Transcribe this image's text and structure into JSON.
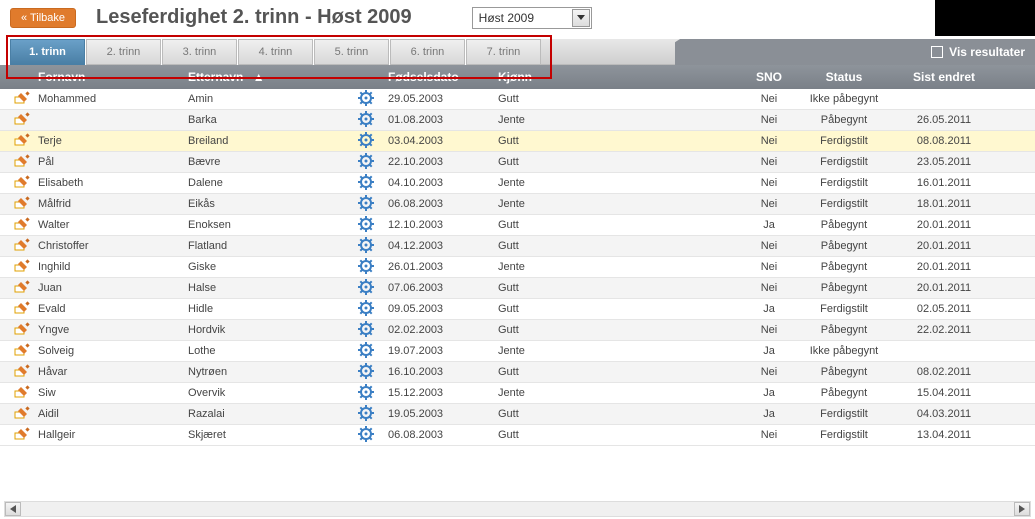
{
  "header": {
    "back_label": "« Tilbake",
    "title": "Leseferdighet 2. trinn - Høst 2009",
    "dropdown_value": "Høst 2009",
    "vis_resultater": "Vis resultater"
  },
  "tabs": [
    {
      "label": "1. trinn",
      "active": true
    },
    {
      "label": "2. trinn",
      "active": false
    },
    {
      "label": "3. trinn",
      "active": false
    },
    {
      "label": "4. trinn",
      "active": false
    },
    {
      "label": "5. trinn",
      "active": false
    },
    {
      "label": "6. trinn",
      "active": false
    },
    {
      "label": "7. trinn",
      "active": false
    }
  ],
  "columns": {
    "fornavn": "Fornavn",
    "etternavn": "Etternavn",
    "fodselsdato": "Fødselsdato",
    "kjonn": "Kjønn",
    "sno": "SNO",
    "status": "Status",
    "sist_endret": "Sist endret"
  },
  "rows": [
    {
      "first": "Mohammed",
      "last": "Amin",
      "date": "29.05.2003",
      "gender": "Gutt",
      "sno": "Nei",
      "status": "Ikke påbegynt",
      "updated": ""
    },
    {
      "first": "",
      "last": "Barka",
      "date": "01.08.2003",
      "gender": "Jente",
      "sno": "Nei",
      "status": "Påbegynt",
      "updated": "26.05.2011"
    },
    {
      "first": "Terje",
      "last": "Breiland",
      "date": "03.04.2003",
      "gender": "Gutt",
      "sno": "Nei",
      "status": "Ferdigstilt",
      "updated": "08.08.2011",
      "highlight": true
    },
    {
      "first": "Pål",
      "last": "Bævre",
      "date": "22.10.2003",
      "gender": "Gutt",
      "sno": "Nei",
      "status": "Ferdigstilt",
      "updated": "23.05.2011"
    },
    {
      "first": "Elisabeth",
      "last": "Dalene",
      "date": "04.10.2003",
      "gender": "Jente",
      "sno": "Nei",
      "status": "Ferdigstilt",
      "updated": "16.01.2011"
    },
    {
      "first": "Målfrid",
      "last": "Eikås",
      "date": "06.08.2003",
      "gender": "Jente",
      "sno": "Nei",
      "status": "Ferdigstilt",
      "updated": "18.01.2011"
    },
    {
      "first": "Walter",
      "last": "Enoksen",
      "date": "12.10.2003",
      "gender": "Gutt",
      "sno": "Ja",
      "status": "Påbegynt",
      "updated": "20.01.2011"
    },
    {
      "first": "Christoffer",
      "last": "Flatland",
      "date": "04.12.2003",
      "gender": "Gutt",
      "sno": "Nei",
      "status": "Påbegynt",
      "updated": "20.01.2011"
    },
    {
      "first": "Inghild",
      "last": "Giske",
      "date": "26.01.2003",
      "gender": "Jente",
      "sno": "Nei",
      "status": "Påbegynt",
      "updated": "20.01.2011"
    },
    {
      "first": "Juan",
      "last": "Halse",
      "date": "07.06.2003",
      "gender": "Gutt",
      "sno": "Nei",
      "status": "Påbegynt",
      "updated": "20.01.2011"
    },
    {
      "first": "Evald",
      "last": "Hidle",
      "date": "09.05.2003",
      "gender": "Gutt",
      "sno": "Ja",
      "status": "Ferdigstilt",
      "updated": "02.05.2011"
    },
    {
      "first": "Yngve",
      "last": "Hordvik",
      "date": "02.02.2003",
      "gender": "Gutt",
      "sno": "Nei",
      "status": "Påbegynt",
      "updated": "22.02.2011"
    },
    {
      "first": "Solveig",
      "last": "Lothe",
      "date": "19.07.2003",
      "gender": "Jente",
      "sno": "Ja",
      "status": "Ikke påbegynt",
      "updated": ""
    },
    {
      "first": "Håvar",
      "last": "Nytrøen",
      "date": "16.10.2003",
      "gender": "Gutt",
      "sno": "Nei",
      "status": "Påbegynt",
      "updated": "08.02.2011"
    },
    {
      "first": "Siw",
      "last": "Overvik",
      "date": "15.12.2003",
      "gender": "Jente",
      "sno": "Ja",
      "status": "Påbegynt",
      "updated": "15.04.2011"
    },
    {
      "first": "Aidil",
      "last": "Razalai",
      "date": "19.05.2003",
      "gender": "Gutt",
      "sno": "Ja",
      "status": "Ferdigstilt",
      "updated": "04.03.2011"
    },
    {
      "first": "Hallgeir",
      "last": "Skjæret",
      "date": "06.08.2003",
      "gender": "Gutt",
      "sno": "Nei",
      "status": "Ferdigstilt",
      "updated": "13.04.2011"
    }
  ]
}
